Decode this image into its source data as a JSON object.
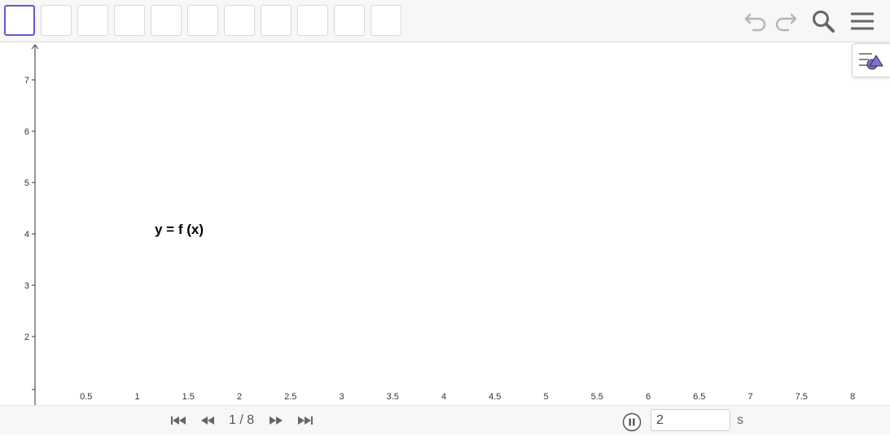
{
  "toolbar": {
    "tool_count": 11,
    "selected_tool": 0,
    "icons": [
      "undo-icon",
      "redo-icon",
      "search-icon",
      "menu-icon"
    ]
  },
  "stylebar": {
    "icon": "style-bar-toggle-icon"
  },
  "graphics": {
    "label": "y = f (x)",
    "x_axis": {
      "min": 0,
      "max": 8,
      "ticks": [
        "0.5",
        "1",
        "1.5",
        "2",
        "2.5",
        "3",
        "3.5",
        "4",
        "4.5",
        "5",
        "5.5",
        "6",
        "6.5",
        "7",
        "7.5",
        "8"
      ]
    },
    "y_axis": {
      "ticks": [
        "2",
        "3",
        "4",
        "5",
        "6",
        "7"
      ]
    }
  },
  "playback": {
    "counter": "1 / 8",
    "duration_value": "2",
    "unit": "s",
    "icons": [
      "skip-first-icon",
      "step-back-icon",
      "step-forward-icon",
      "skip-last-icon",
      "pause-icon"
    ]
  }
}
